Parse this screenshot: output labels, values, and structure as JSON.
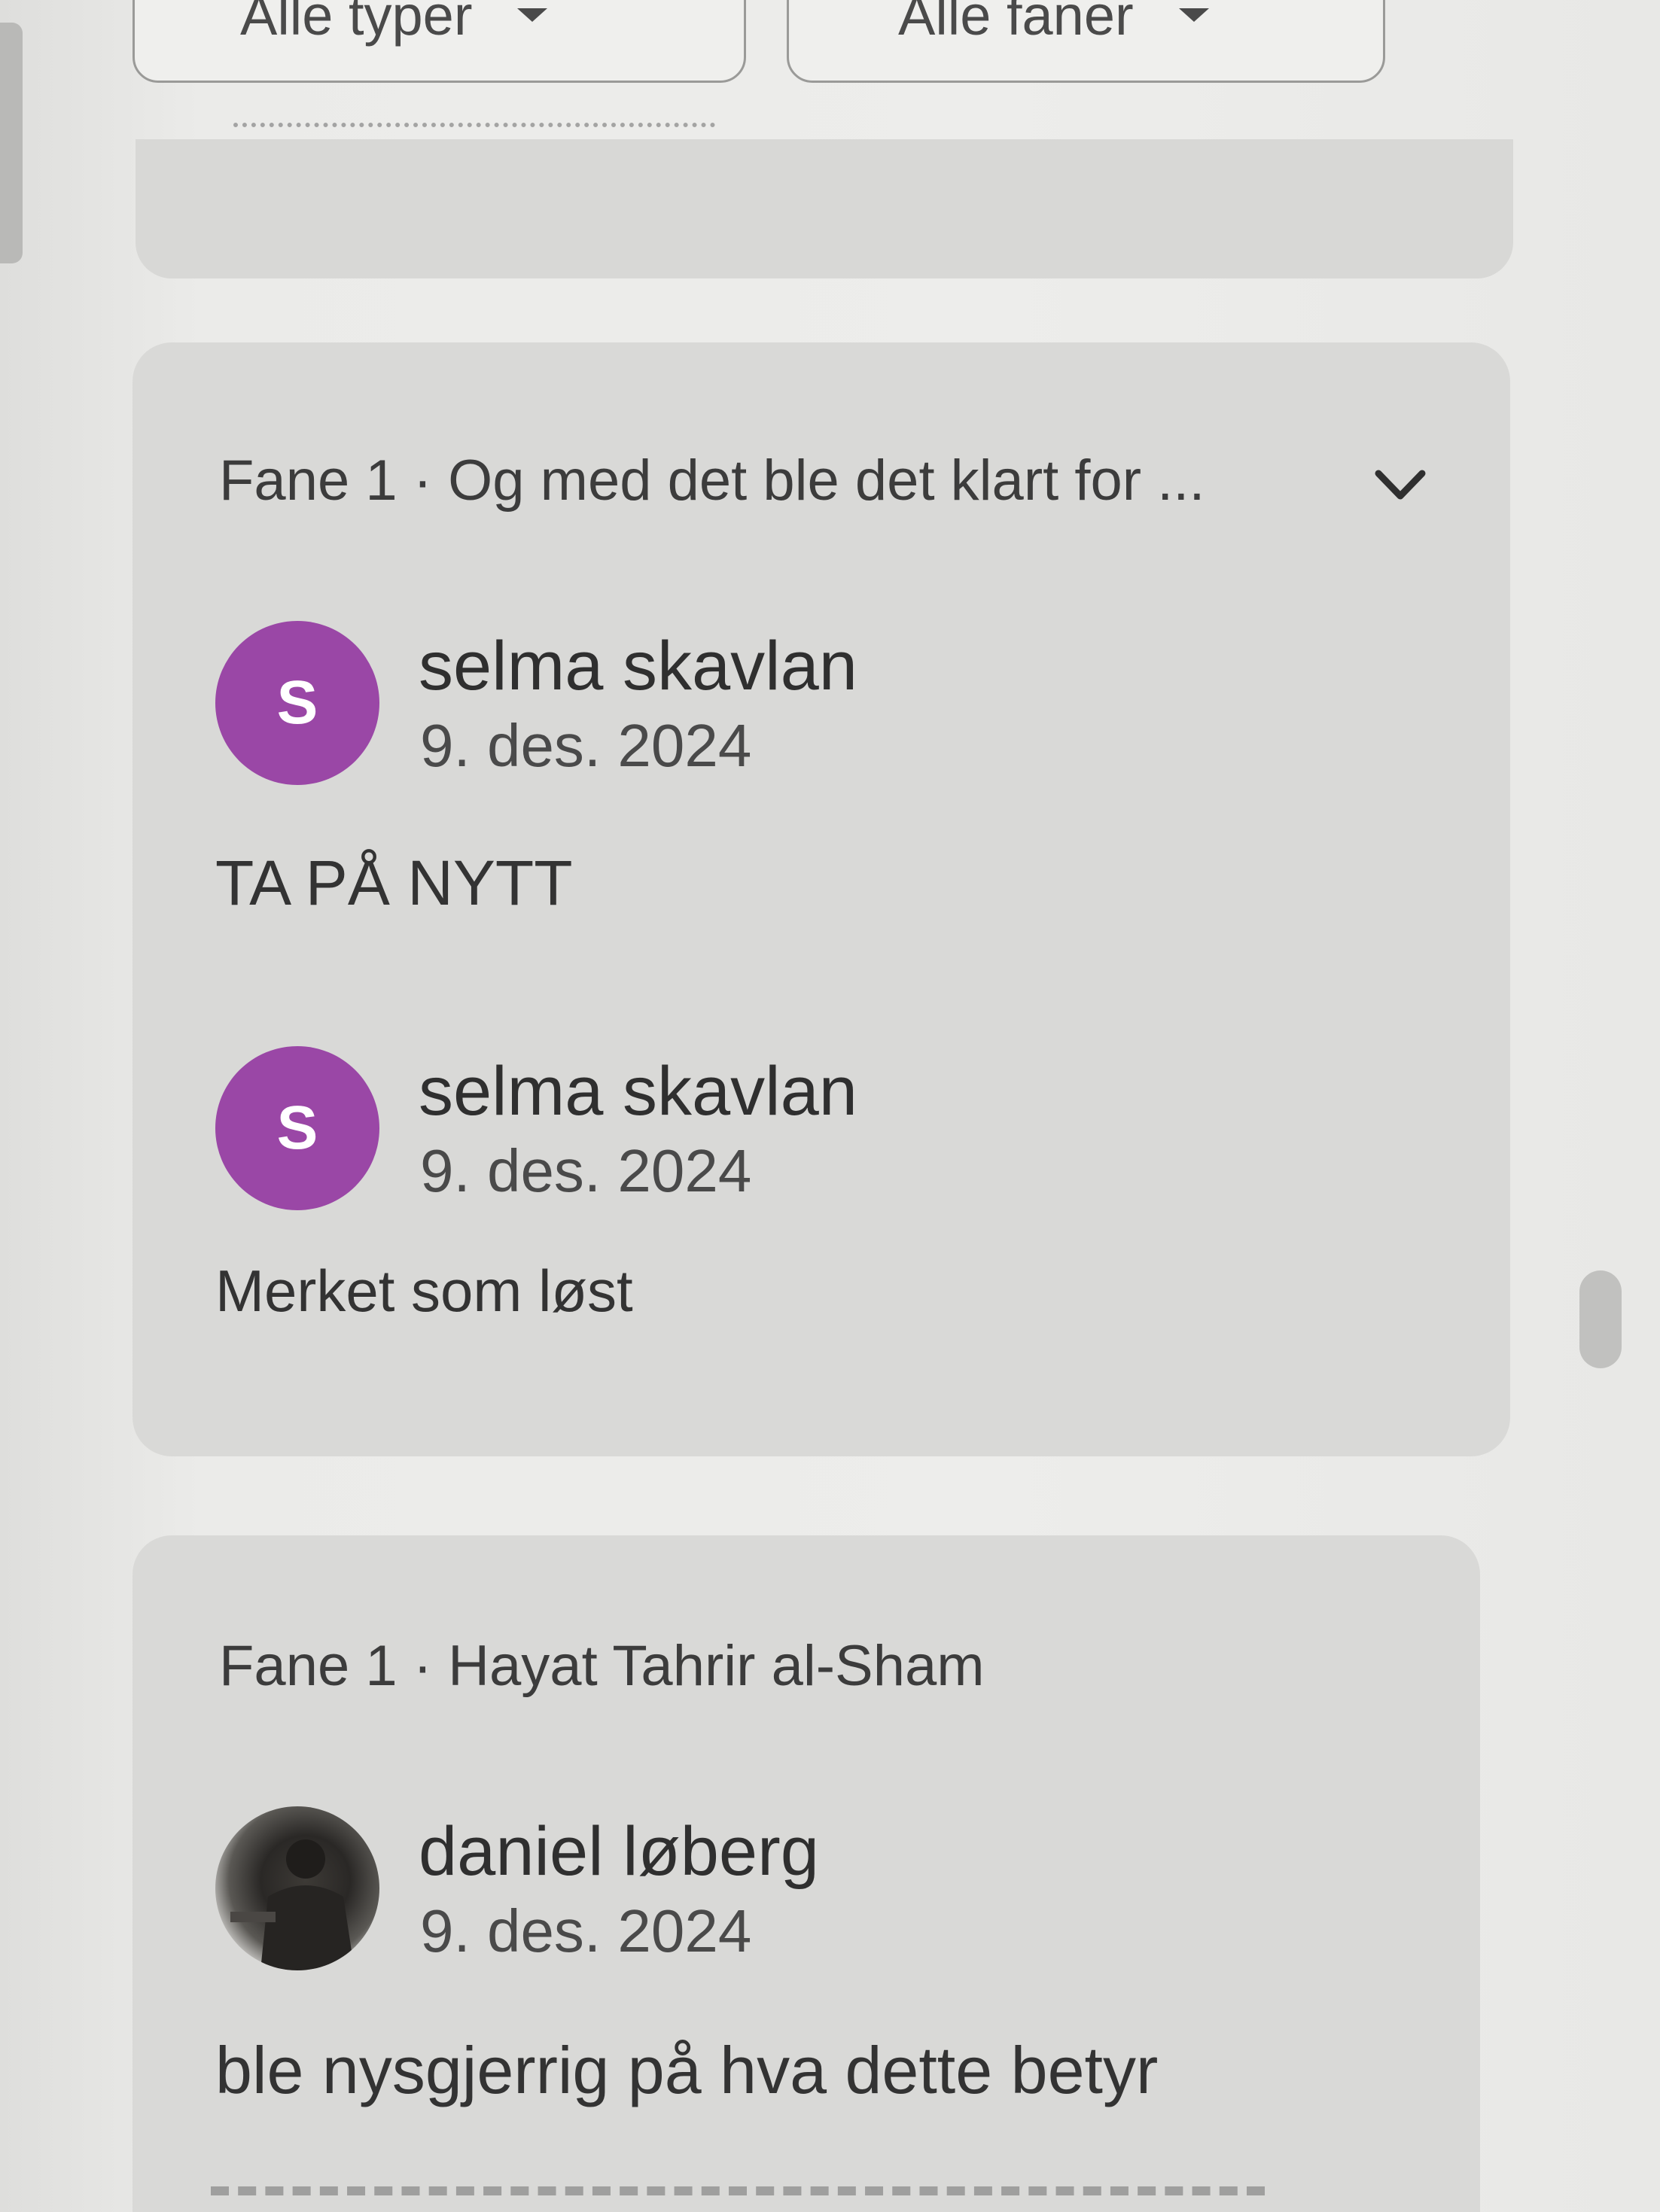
{
  "filters": {
    "types_label": "Alle typer",
    "tabs_label": "Alle faner"
  },
  "threads": [
    {
      "header": "Fane 1 · Og med det ble det klart for ...",
      "comments": [
        {
          "avatar_letter": "S",
          "author": "selma skavlan",
          "date": "9. des. 2024",
          "text": "TA PÅ NYTT"
        },
        {
          "avatar_letter": "S",
          "author": "selma skavlan",
          "date": "9. des. 2024",
          "text": "Merket som løst"
        }
      ]
    },
    {
      "header": "Fane 1 · Hayat Tahrir al-Sham",
      "comments": [
        {
          "avatar_letter": "",
          "author": "daniel løberg",
          "date": "9. des. 2024",
          "text": "ble nysgjerrig på hva dette betyr"
        }
      ]
    }
  ],
  "colors": {
    "avatar_purple": "#9a47a6",
    "card_background": "#d9d9d7",
    "page_background": "#ececea"
  },
  "icons": {
    "expand": "chevron-down-icon",
    "dropdown": "caret-down-icon"
  }
}
